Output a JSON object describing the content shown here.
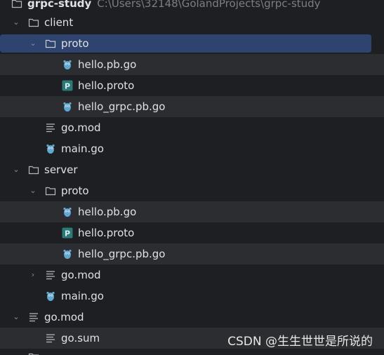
{
  "project": {
    "name": "grpc-study",
    "path": "C:\\Users\\32148\\GolandProjects\\grpc-study"
  },
  "tree": {
    "client": {
      "label": "client"
    },
    "client_proto": {
      "label": "proto"
    },
    "client_proto_hello_pb": {
      "label": "hello.pb.go"
    },
    "client_proto_hello_proto": {
      "label": "hello.proto"
    },
    "client_proto_hello_grpc": {
      "label": "hello_grpc.pb.go"
    },
    "client_go_mod": {
      "label": "go.mod"
    },
    "client_main": {
      "label": "main.go"
    },
    "server": {
      "label": "server"
    },
    "server_proto": {
      "label": "proto"
    },
    "server_proto_hello_pb": {
      "label": "hello.pb.go"
    },
    "server_proto_hello_proto": {
      "label": "hello.proto"
    },
    "server_proto_hello_grpc": {
      "label": "hello_grpc.pb.go"
    },
    "server_go_mod": {
      "label": "go.mod"
    },
    "server_main": {
      "label": "main.go"
    },
    "root_go_mod": {
      "label": "go.mod"
    },
    "root_go_sum": {
      "label": "go.sum"
    }
  },
  "watermark": "CSDN @生生世世是所说的",
  "colors": {
    "background": "#1e1f22",
    "stripe": "#2b2d30",
    "selection": "#2e436e",
    "gopher": "#5fa8d3",
    "proto_badge": "#2b7a78"
  }
}
